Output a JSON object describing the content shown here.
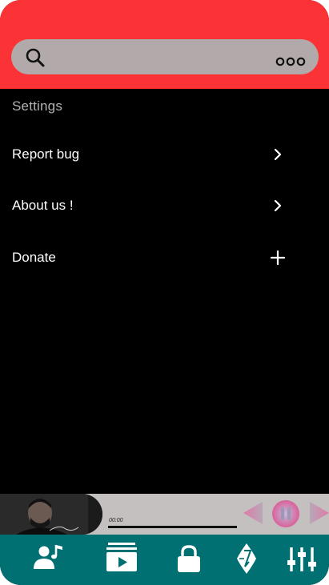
{
  "settings": {
    "section_label": "Settings",
    "items": [
      {
        "label": "Report bug",
        "trailing_icon": "chevron-right-icon"
      },
      {
        "label": "About us !",
        "trailing_icon": "chevron-right-icon"
      },
      {
        "label": "Donate",
        "trailing_icon": "plus-icon"
      }
    ]
  },
  "player": {
    "time": "00:00",
    "progress": 0
  },
  "bottom_nav": [
    "artists-icon",
    "videos-icon",
    "lock-icon",
    "music-brand-icon",
    "equalizer-icon"
  ],
  "colors": {
    "header": "#fc3336",
    "search_bar": "#b2aaaa",
    "background": "#000000",
    "player_bar": "#c4c0c0",
    "nav_bar": "#007072",
    "controls_accent": "#e07aa8"
  }
}
